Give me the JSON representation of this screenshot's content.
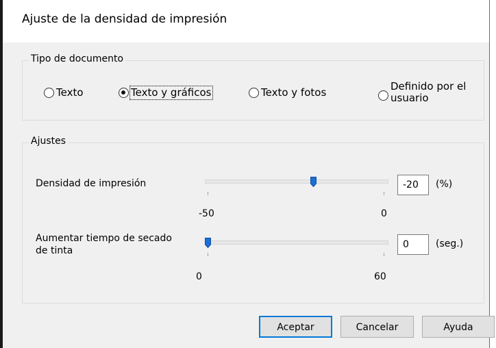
{
  "dialog": {
    "title": "Ajuste de la densidad de impresión"
  },
  "document_type": {
    "legend": "Tipo de documento",
    "options": [
      {
        "label": "Texto",
        "checked": false
      },
      {
        "label": "Texto y gráficos",
        "checked": true
      },
      {
        "label": "Texto y fotos",
        "checked": false
      },
      {
        "label_line1": "Definido por el",
        "label_line2": "usuario",
        "checked": false
      }
    ]
  },
  "settings": {
    "legend": "Ajustes",
    "density": {
      "label": "Densidad de impresión",
      "value": "-20",
      "unit": "(%)",
      "min_label": "-50",
      "max_label": "0",
      "slider_value": -20
    },
    "dry_time": {
      "label_line1": "Aumentar tiempo de secado",
      "label_line2": "de tinta",
      "value": "0",
      "unit": "(seg.)",
      "min_label": "0",
      "max_label": "60",
      "slider_value": 0
    }
  },
  "buttons": {
    "ok": "Aceptar",
    "cancel": "Cancelar",
    "help": "Ayuda"
  },
  "colors": {
    "accent": "#0078d7",
    "window_bg": "#f0f0f0",
    "thumb": "#1b6fd6"
  }
}
